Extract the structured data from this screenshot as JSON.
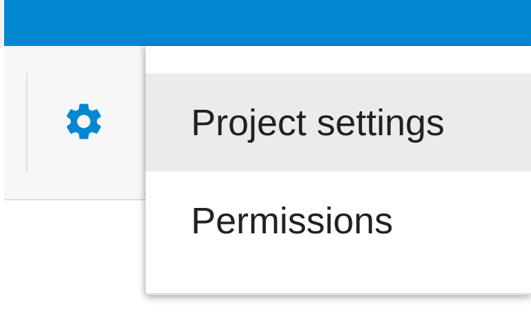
{
  "header": {
    "bar_color": "#0288d1"
  },
  "toolbar": {
    "settings_icon": "gear-icon",
    "icon_color": "#0288d1"
  },
  "menu": {
    "items": [
      {
        "label": "Project settings",
        "state": "hovered"
      },
      {
        "label": "Permissions",
        "state": "default"
      }
    ]
  }
}
